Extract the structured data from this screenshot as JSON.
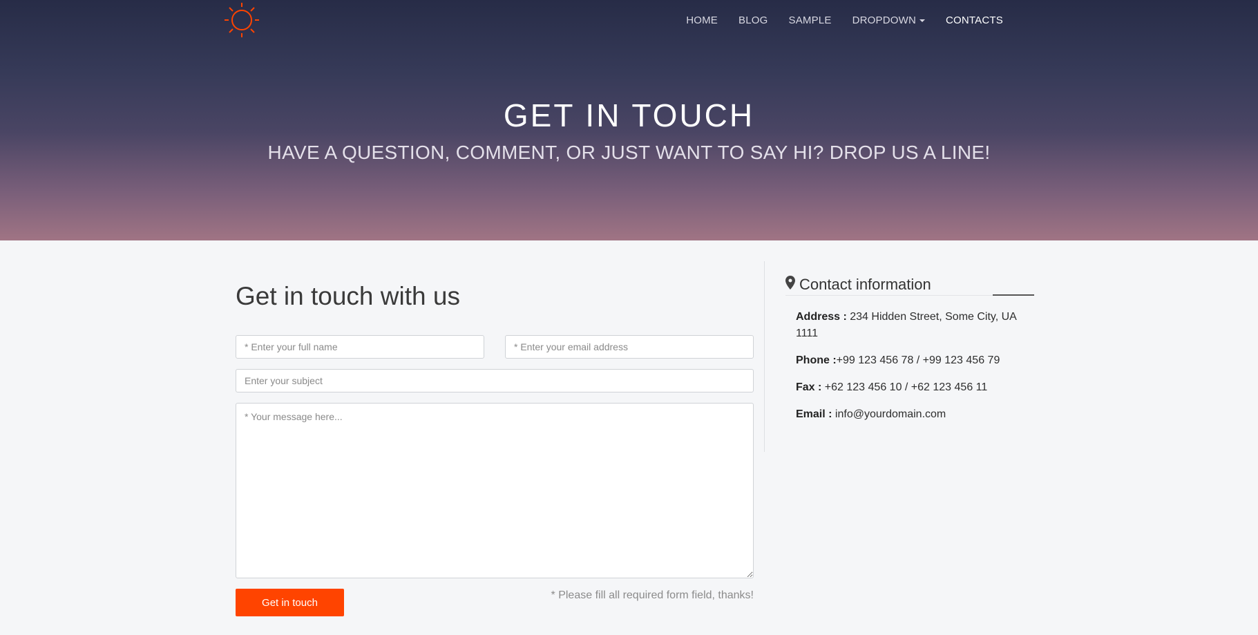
{
  "nav": {
    "items": [
      {
        "label": "HOME"
      },
      {
        "label": "BLOG"
      },
      {
        "label": "SAMPLE"
      },
      {
        "label": "DROPDOWN"
      },
      {
        "label": "CONTACTS"
      }
    ],
    "active": "CONTACTS",
    "logo_icon": "sun-icon",
    "logo_color": "#ff4400"
  },
  "hero": {
    "title": "GET IN TOUCH",
    "subtitle": "HAVE A QUESTION, COMMENT, OR JUST WANT TO SAY HI? DROP US A LINE!"
  },
  "form": {
    "title": "Get in touch with us",
    "name_placeholder": "* Enter your full name",
    "email_placeholder": "* Enter your email address",
    "subject_placeholder": "Enter your subject",
    "message_placeholder": "* Your message here...",
    "submit_label": "Get in touch",
    "required_note": "* Please fill all required form field, thanks!",
    "accent_color": "#ff4400"
  },
  "contact": {
    "heading": "Contact information",
    "heading_icon": "map-marker-icon",
    "address_label": "Address :",
    "address_value": "234 Hidden Street, Some City, UA 1111",
    "phone_label": "Phone :",
    "phone_value": "+99 123 456 78 / +99 123 456 79",
    "fax_label": "Fax :",
    "fax_value": "+62 123 456 10 / +62 123 456 11",
    "email_label": "Email :",
    "email_value": "info@yourdomain.com"
  }
}
